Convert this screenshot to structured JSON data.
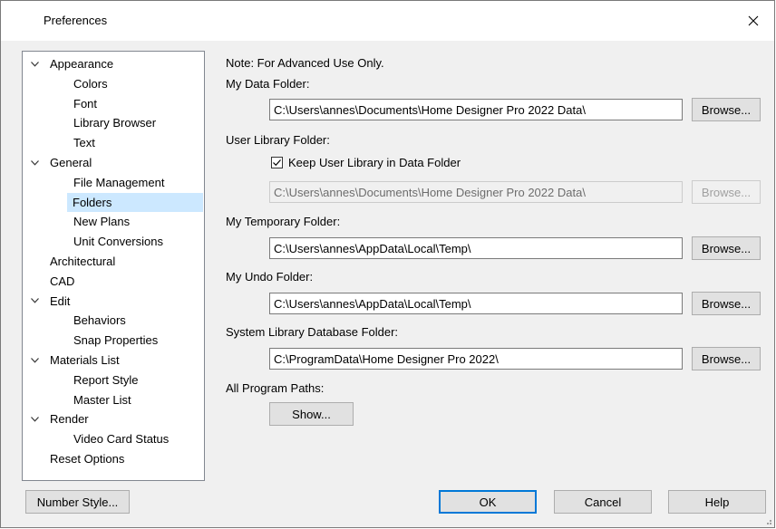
{
  "window": {
    "title": "Preferences"
  },
  "tree": {
    "items": [
      {
        "label": "Appearance",
        "level": 0,
        "expandable": true
      },
      {
        "label": "Colors",
        "level": 1
      },
      {
        "label": "Font",
        "level": 1
      },
      {
        "label": "Library Browser",
        "level": 1
      },
      {
        "label": "Text",
        "level": 1
      },
      {
        "label": "General",
        "level": 0,
        "expandable": true
      },
      {
        "label": "File Management",
        "level": 1
      },
      {
        "label": "Folders",
        "level": 1,
        "selected": true
      },
      {
        "label": "New Plans",
        "level": 1
      },
      {
        "label": "Unit Conversions",
        "level": 1
      },
      {
        "label": "Architectural",
        "level": 0
      },
      {
        "label": "CAD",
        "level": 0
      },
      {
        "label": "Edit",
        "level": 0,
        "expandable": true
      },
      {
        "label": "Behaviors",
        "level": 1
      },
      {
        "label": "Snap Properties",
        "level": 1
      },
      {
        "label": "Materials List",
        "level": 0,
        "expandable": true
      },
      {
        "label": "Report Style",
        "level": 1
      },
      {
        "label": "Master List",
        "level": 1
      },
      {
        "label": "Render",
        "level": 0,
        "expandable": true
      },
      {
        "label": "Video Card Status",
        "level": 1
      },
      {
        "label": "Reset Options",
        "level": 0
      }
    ]
  },
  "folders": {
    "note": "Note: For Advanced Use Only.",
    "my_data": {
      "label": "My Data Folder:",
      "value": "C:\\Users\\annes\\Documents\\Home Designer Pro 2022 Data\\",
      "browse": "Browse..."
    },
    "user_library": {
      "label": "User Library Folder:",
      "checkbox_label": "Keep User Library in Data Folder",
      "checked": true,
      "value": "C:\\Users\\annes\\Documents\\Home Designer Pro 2022 Data\\",
      "browse": "Browse..."
    },
    "temporary": {
      "label": "My Temporary Folder:",
      "value": "C:\\Users\\annes\\AppData\\Local\\Temp\\",
      "browse": "Browse..."
    },
    "undo": {
      "label": "My Undo Folder:",
      "value": "C:\\Users\\annes\\AppData\\Local\\Temp\\",
      "browse": "Browse..."
    },
    "system_library": {
      "label": "System Library Database Folder:",
      "value": "C:\\ProgramData\\Home Designer Pro 2022\\",
      "browse": "Browse..."
    },
    "all_paths": {
      "label": "All Program Paths:",
      "show": "Show..."
    }
  },
  "footer": {
    "number_style": "Number Style...",
    "ok": "OK",
    "cancel": "Cancel",
    "help": "Help"
  },
  "colors": {
    "selection": "#cce8ff",
    "default_button_border": "#0078d7"
  }
}
